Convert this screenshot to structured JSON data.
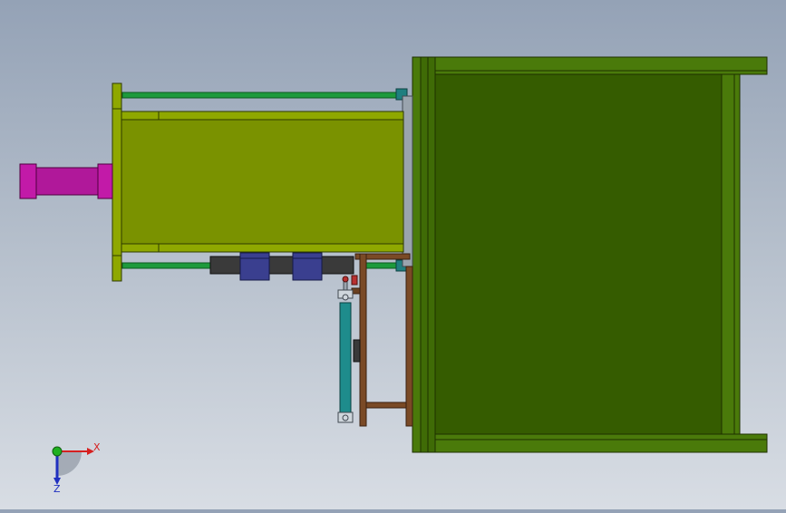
{
  "viewport": {
    "background_top": "#94a2b6",
    "background_bottom": "#d8dde4"
  },
  "colors": {
    "frame_dark_green": "#355c00",
    "frame_green": "#3f6b06",
    "hopper_olive": "#7a9200",
    "cylinder_magenta": "#b0189a",
    "tie_rod_green": "#1d9a3c",
    "guide_cylinder_teal": "#1e8c8c",
    "bracket_brown": "#7a4a26",
    "block_navy": "#3a3f8f",
    "bar_dark_gray": "#3a3a3a",
    "plate_gray": "#9aa4ae"
  },
  "triad": {
    "x_label": "X",
    "z_label": "Z",
    "x_color": "#d62020",
    "z_color": "#2030c0",
    "y_color": "#20b020"
  }
}
